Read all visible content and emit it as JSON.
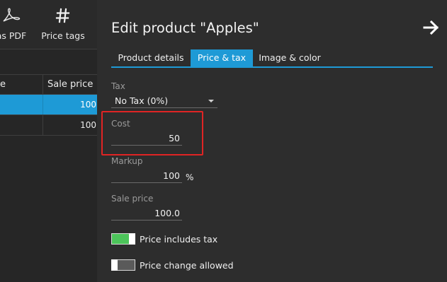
{
  "toolbar": {
    "pdf_label": "as PDF",
    "pdf_icon": "pdf-icon",
    "price_tags_label": "Price tags",
    "price_tags_icon": "hash-icon"
  },
  "grid": {
    "columns": [
      "e",
      "Sale price"
    ],
    "rows": [
      {
        "sale_price": "100",
        "selected": true
      },
      {
        "sale_price": "100",
        "selected": false
      }
    ]
  },
  "panel": {
    "title": "Edit product \"Apples\"",
    "close_icon": "arrow-right-icon",
    "tabs": [
      {
        "label": "Product details",
        "active": false
      },
      {
        "label": "Price & tax",
        "active": true
      },
      {
        "label": "Image & color",
        "active": false
      }
    ],
    "tax": {
      "label": "Tax",
      "value": "No Tax (0%)"
    },
    "cost": {
      "label": "Cost",
      "value": "50"
    },
    "markup": {
      "label": "Markup",
      "value": "100",
      "unit": "%"
    },
    "sale_price": {
      "label": "Sale price",
      "value": "100.0"
    },
    "toggles": [
      {
        "label": "Price includes tax",
        "on": true
      },
      {
        "label": "Price change allowed",
        "on": false
      }
    ]
  },
  "colors": {
    "accent": "#1e9ad6",
    "toggle_on": "#4cc45a",
    "highlight": "#e02424",
    "panel_bg": "#2d2d2d"
  }
}
